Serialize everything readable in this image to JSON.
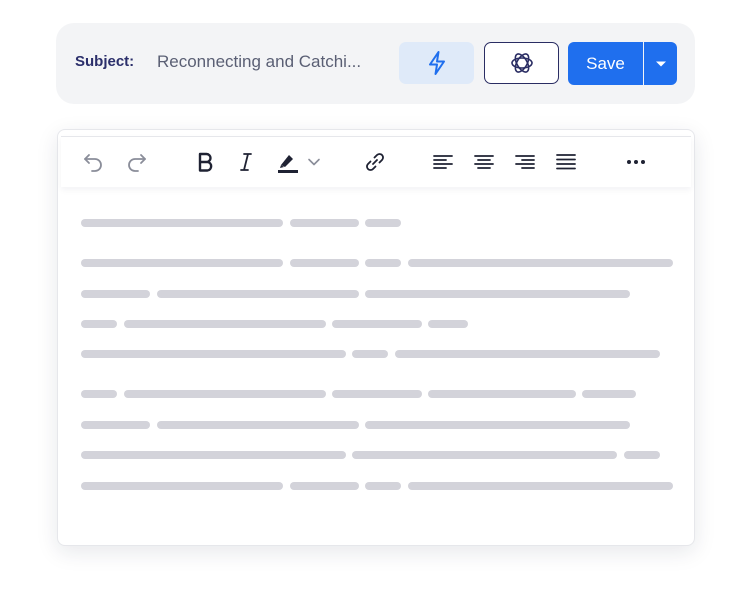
{
  "subject": {
    "label": "Subject:",
    "value": "Reconnecting and Catchi..."
  },
  "actions": {
    "bolt_icon": "lightning-icon",
    "ai_icon": "openai-icon",
    "save_label": "Save",
    "dropdown_icon": "caret-down-icon"
  },
  "toolbar": {
    "items": [
      "undo-icon",
      "redo-icon",
      "bold-icon",
      "italic-icon",
      "highlight-icon",
      "chevron-down-icon",
      "link-icon",
      "align-left-icon",
      "align-center-icon",
      "align-right-icon",
      "align-justify-icon",
      "more-icon"
    ]
  },
  "colors": {
    "primary": "#1f6fee",
    "bolt_bg": "#dfeaf9",
    "navy": "#2a2d63",
    "skeleton": "#d3d3da"
  }
}
